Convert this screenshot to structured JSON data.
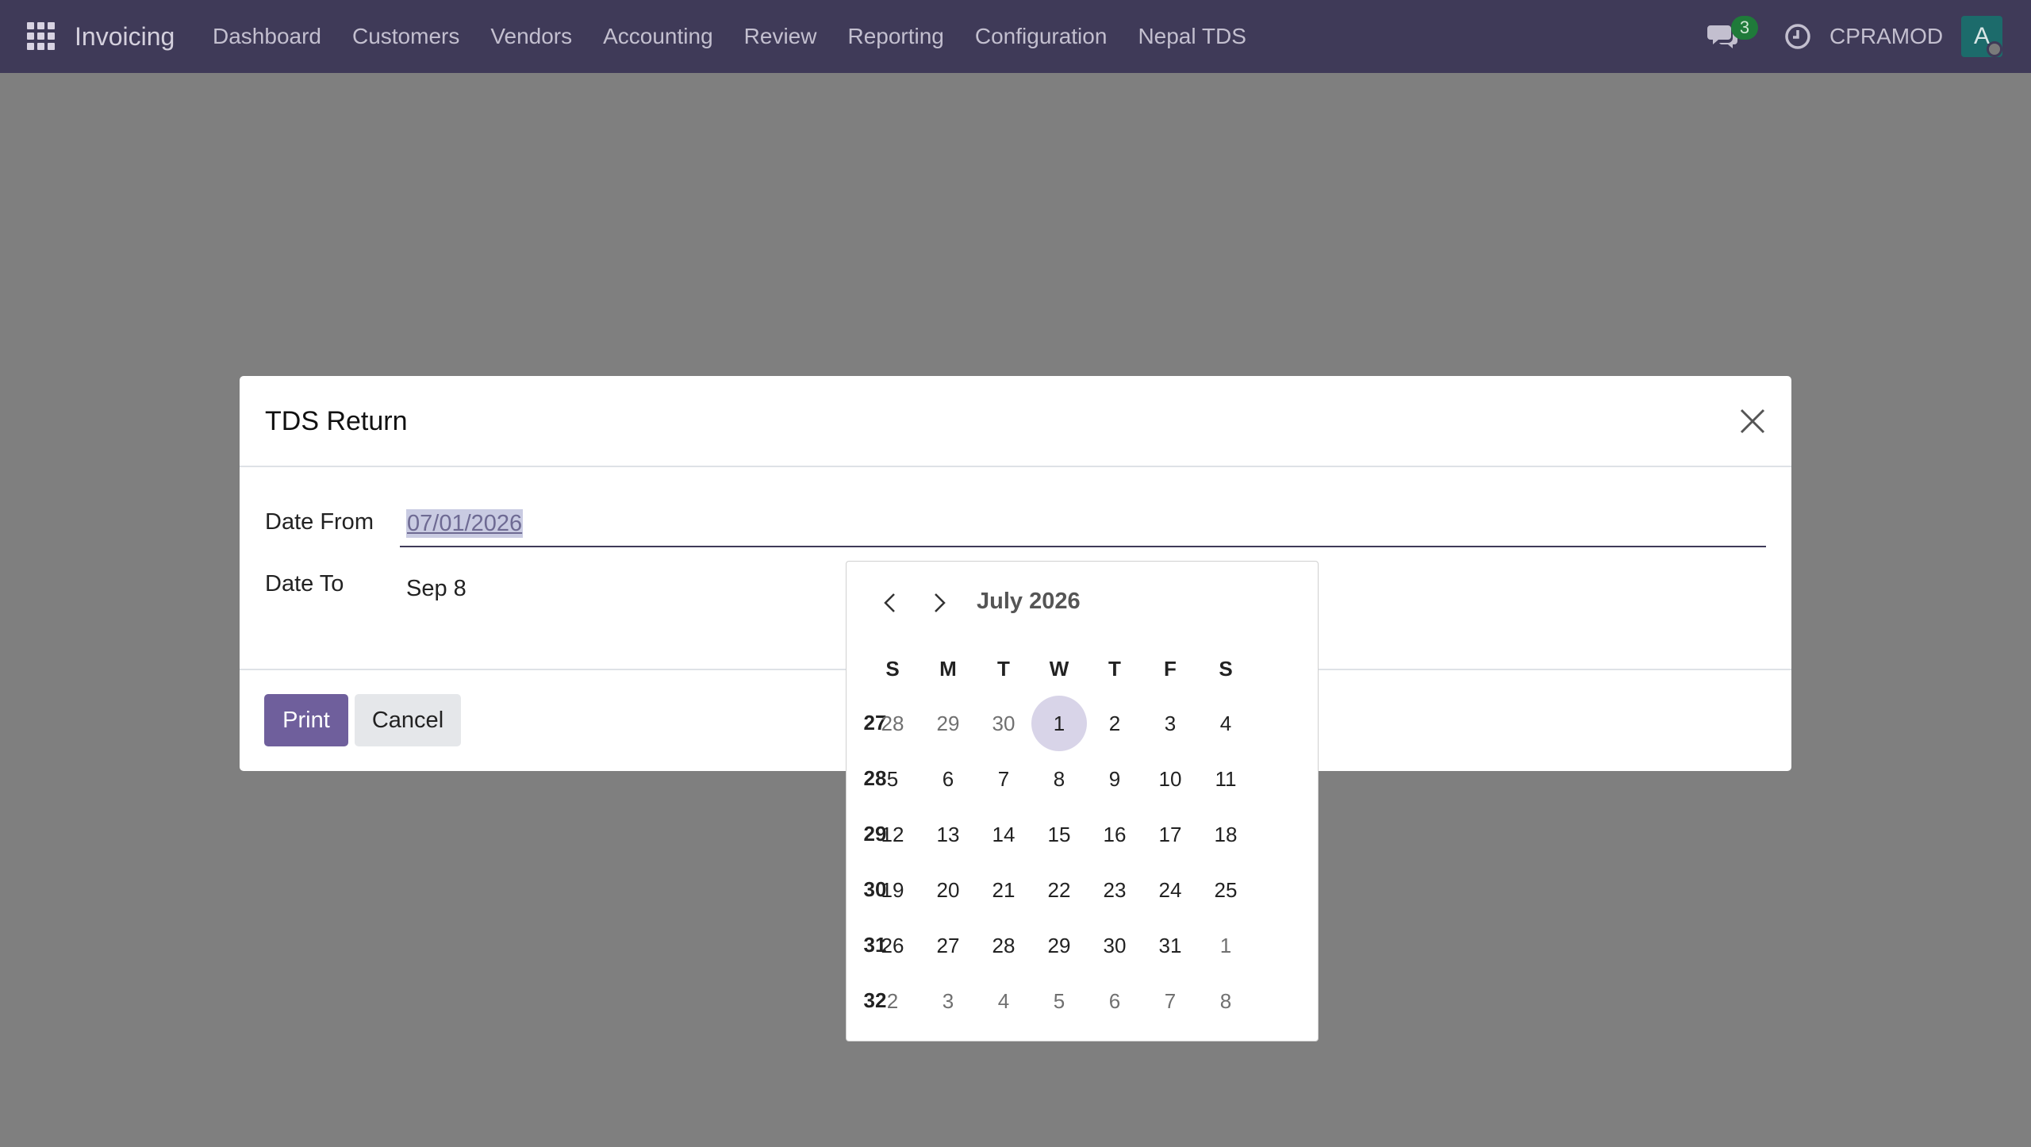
{
  "navbar": {
    "app_name": "Invoicing",
    "menu": [
      "Dashboard",
      "Customers",
      "Vendors",
      "Accounting",
      "Review",
      "Reporting",
      "Configuration",
      "Nepal TDS"
    ],
    "chat_count": "3",
    "username": "CPRAMOD",
    "avatar_letter": "A"
  },
  "dialog": {
    "title": "TDS Return",
    "date_from_label": "Date From",
    "date_from_value": "07/01/2026",
    "date_to_label": "Date To",
    "date_to_value": "Sep 8",
    "print_label": "Print",
    "cancel_label": "Cancel"
  },
  "datepicker": {
    "month_label": "July 2026",
    "weekdays": [
      "S",
      "M",
      "T",
      "W",
      "T",
      "F",
      "S"
    ],
    "weeks": [
      {
        "number": "27",
        "days": [
          {
            "d": "28",
            "muted": true
          },
          {
            "d": "29",
            "muted": true
          },
          {
            "d": "30",
            "muted": true
          },
          {
            "d": "1",
            "selected": true
          },
          {
            "d": "2"
          },
          {
            "d": "3"
          },
          {
            "d": "4"
          }
        ]
      },
      {
        "number": "28",
        "days": [
          {
            "d": "5"
          },
          {
            "d": "6"
          },
          {
            "d": "7"
          },
          {
            "d": "8"
          },
          {
            "d": "9"
          },
          {
            "d": "10"
          },
          {
            "d": "11"
          }
        ]
      },
      {
        "number": "29",
        "days": [
          {
            "d": "12"
          },
          {
            "d": "13"
          },
          {
            "d": "14"
          },
          {
            "d": "15"
          },
          {
            "d": "16"
          },
          {
            "d": "17"
          },
          {
            "d": "18"
          }
        ]
      },
      {
        "number": "30",
        "days": [
          {
            "d": "19"
          },
          {
            "d": "20"
          },
          {
            "d": "21"
          },
          {
            "d": "22"
          },
          {
            "d": "23"
          },
          {
            "d": "24"
          },
          {
            "d": "25"
          }
        ]
      },
      {
        "number": "31",
        "days": [
          {
            "d": "26"
          },
          {
            "d": "27"
          },
          {
            "d": "28"
          },
          {
            "d": "29"
          },
          {
            "d": "30"
          },
          {
            "d": "31"
          },
          {
            "d": "1",
            "muted": true
          }
        ]
      },
      {
        "number": "32",
        "days": [
          {
            "d": "2",
            "muted": true
          },
          {
            "d": "3",
            "muted": true
          },
          {
            "d": "4",
            "muted": true
          },
          {
            "d": "5",
            "muted": true
          },
          {
            "d": "6",
            "muted": true
          },
          {
            "d": "7",
            "muted": true
          },
          {
            "d": "8",
            "muted": true
          }
        ]
      }
    ]
  }
}
